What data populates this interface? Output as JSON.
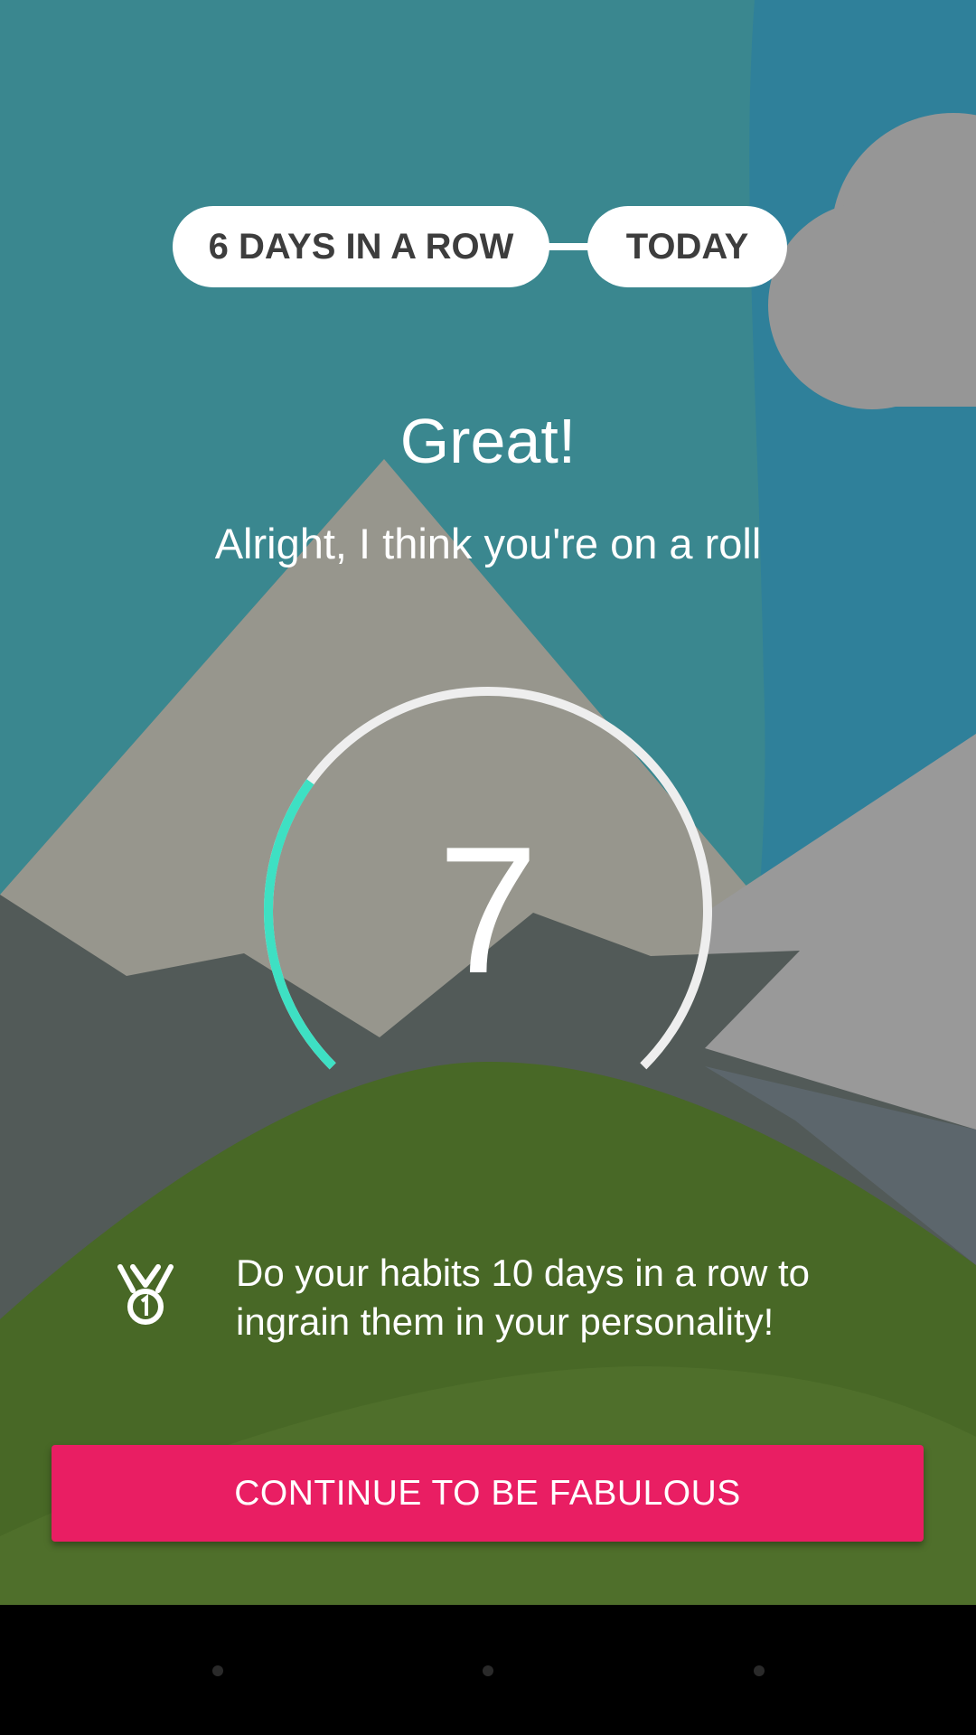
{
  "streak": {
    "days_label": "6 DAYS IN A ROW",
    "today_label": "TODAY"
  },
  "message": {
    "title": "Great!",
    "subtitle": "Alright, I think you're on a roll"
  },
  "progress": {
    "count": "7",
    "fraction_complete": 0.3,
    "accent_color": "#3ee0c3",
    "track_color": "#eeeeee"
  },
  "tip": {
    "icon": "medal-icon",
    "text": "Do your habits 10 days in a row to ingrain them in your personality!"
  },
  "cta": {
    "label": "CONTINUE TO BE FABULOUS",
    "color": "#e91e63"
  },
  "navbar": {
    "icons": [
      "back-icon",
      "home-icon",
      "recents-icon"
    ]
  }
}
